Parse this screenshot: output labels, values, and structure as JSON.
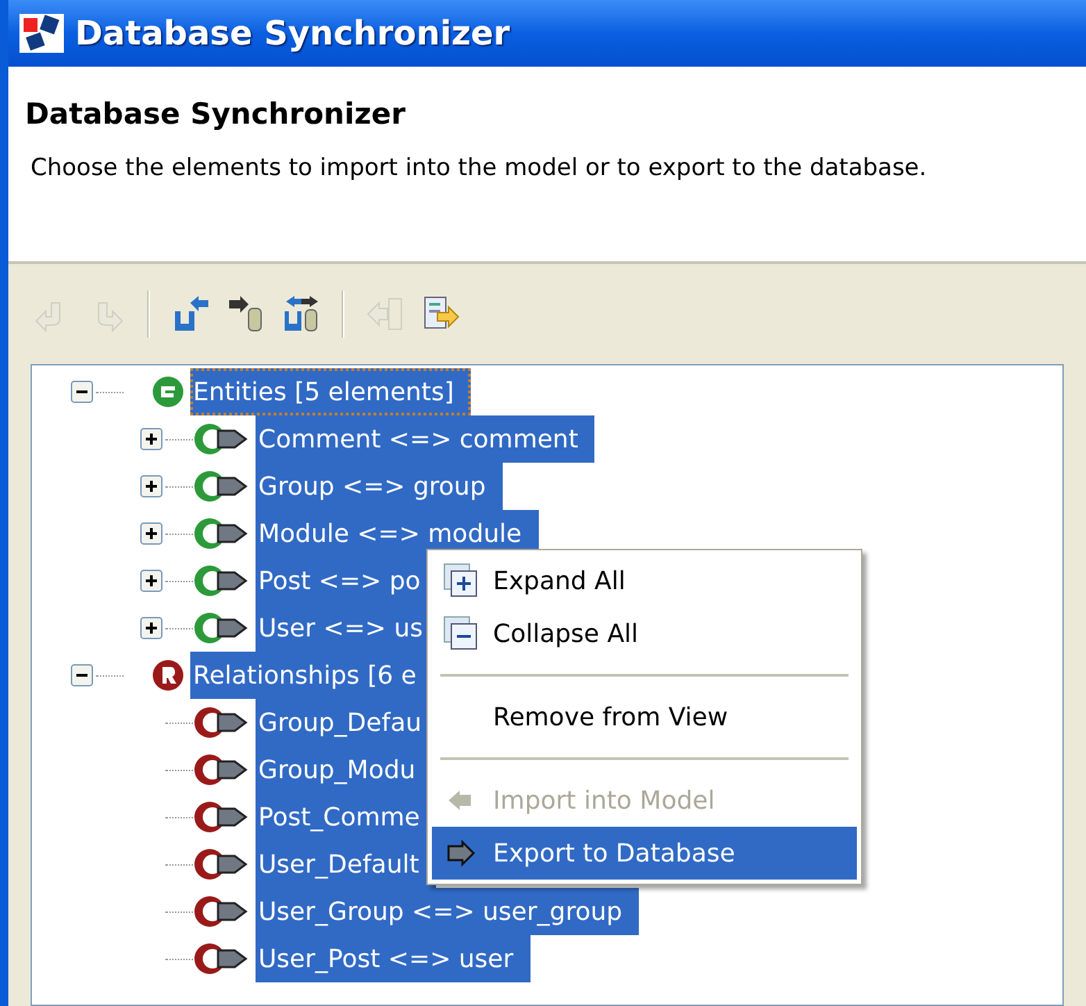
{
  "window": {
    "title": "Database Synchronizer"
  },
  "header": {
    "title": "Database Synchronizer",
    "description": "Choose the elements to import into the model or to export to the database."
  },
  "toolbar": [
    {
      "kind": "undo",
      "disabled": true
    },
    {
      "kind": "redo",
      "disabled": true
    },
    {
      "kind": "separator"
    },
    {
      "kind": "import-db",
      "disabled": false
    },
    {
      "kind": "export-db",
      "disabled": false
    },
    {
      "kind": "sync",
      "disabled": false
    },
    {
      "kind": "separator"
    },
    {
      "kind": "import-model",
      "disabled": true
    },
    {
      "kind": "export-file",
      "disabled": false
    }
  ],
  "tree": [
    {
      "label": "Entities  [5 elements]",
      "kind": "entity-group",
      "expanded": true,
      "selected": true,
      "focused": true,
      "children": [
        {
          "label": "Comment <=> comment",
          "kind": "entity",
          "expanded": false,
          "selected": true
        },
        {
          "label": "Group <=> group",
          "kind": "entity",
          "expanded": false,
          "selected": true
        },
        {
          "label": "Module <=> module",
          "kind": "entity",
          "expanded": false,
          "selected": true
        },
        {
          "label": "Post <=> po",
          "kind": "entity",
          "expanded": false,
          "selected": true
        },
        {
          "label": "User <=> us",
          "kind": "entity",
          "expanded": false,
          "selected": true
        }
      ]
    },
    {
      "label": "Relationships  [6 e",
      "kind": "relationship-group",
      "expanded": true,
      "selected": true,
      "focused": false,
      "children": [
        {
          "label": "Group_Defau",
          "kind": "relationship",
          "selected": true
        },
        {
          "label": "Group_Modu",
          "kind": "relationship",
          "selected": true
        },
        {
          "label": "Post_Comme",
          "kind": "relationship",
          "selected": true
        },
        {
          "label": "User_Default",
          "kind": "relationship",
          "selected": true
        },
        {
          "label": "User_Group <=> user_group",
          "kind": "relationship",
          "selected": true
        },
        {
          "label": "User_Post <=> user",
          "kind": "relationship",
          "selected": true
        }
      ]
    }
  ],
  "context_menu": [
    {
      "kind": "expand",
      "label": "Expand All",
      "disabled": false,
      "selected": false
    },
    {
      "kind": "collapse",
      "label": "Collapse All",
      "disabled": false,
      "selected": false
    },
    {
      "kind": "separator"
    },
    {
      "kind": "plain",
      "label": "Remove from View",
      "disabled": false,
      "selected": false
    },
    {
      "kind": "separator"
    },
    {
      "kind": "import",
      "label": "Import into Model",
      "disabled": true,
      "selected": false
    },
    {
      "kind": "export",
      "label": "Export to Database",
      "disabled": false,
      "selected": true
    }
  ]
}
